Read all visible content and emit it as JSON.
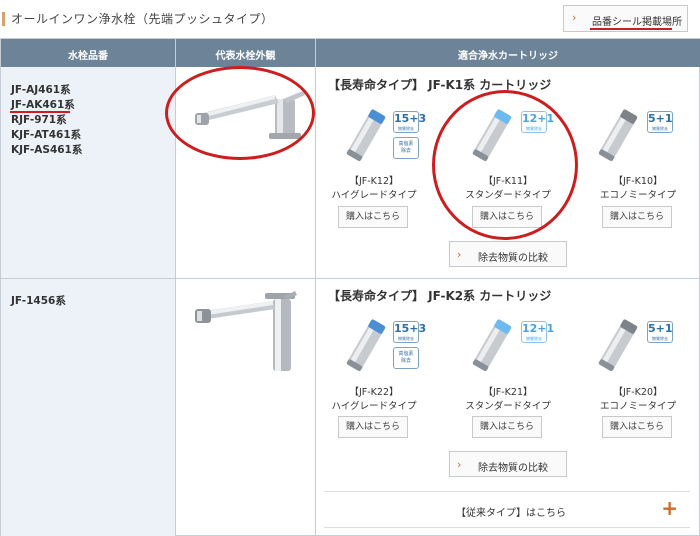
{
  "header": {
    "title": "オールインワン浄水栓（先端プッシュタイプ）",
    "label_button": "品番シール掲載場所"
  },
  "table": {
    "columns": [
      "水栓品番",
      "代表水栓外観",
      "適合浄水カートリッジ"
    ]
  },
  "rows": [
    {
      "models": [
        "JF-AJ461系",
        "JF-AK461系",
        "RJF-971系",
        "KJF-AT461系",
        "KJF-AS461系"
      ],
      "section_title": "【長寿命タイプ】 JF-K1系 カートリッジ",
      "cartridges": [
        {
          "code": "【JF-K12】",
          "type": "ハイグレードタイプ",
          "badge": "15+3",
          "badge_sub": "物質除去",
          "extra_badge": "高塩素\n除去",
          "buy": "購入はこちら"
        },
        {
          "code": "【JF-K11】",
          "type": "スタンダードタイプ",
          "badge": "12+1",
          "badge_sub": "物質除去",
          "buy": "購入はこちら"
        },
        {
          "code": "【JF-K10】",
          "type": "エコノミータイプ",
          "badge": "5+1",
          "badge_sub": "物質除去",
          "buy": "購入はこちら"
        }
      ],
      "compare": "除去物質の比較"
    },
    {
      "models": [
        "JF-1456系"
      ],
      "section_title": "【長寿命タイプ】 JF-K2系 カートリッジ",
      "cartridges": [
        {
          "code": "【JF-K22】",
          "type": "ハイグレードタイプ",
          "badge": "15+3",
          "badge_sub": "物質除去",
          "extra_badge": "高塩素\n除去",
          "buy": "購入はこちら"
        },
        {
          "code": "【JF-K21】",
          "type": "スタンダードタイプ",
          "badge": "12+1",
          "badge_sub": "物質除去",
          "buy": "購入はこちら"
        },
        {
          "code": "【JF-K20】",
          "type": "エコノミータイプ",
          "badge": "5+1",
          "badge_sub": "物質除去",
          "buy": "購入はこちら"
        }
      ],
      "compare": "除去物質の比較",
      "legacy_link": "【従来タイプ】はこちら"
    }
  ],
  "colors": {
    "header_bg": "#6d8397",
    "model_col_bg": "#edf2f9",
    "annotation_red": "#cc1e1e",
    "accent_orange": "#d06a2a",
    "badge_blue": "#2f6fa8"
  },
  "icons": [
    "chevron-right-icon",
    "plus-icon"
  ]
}
